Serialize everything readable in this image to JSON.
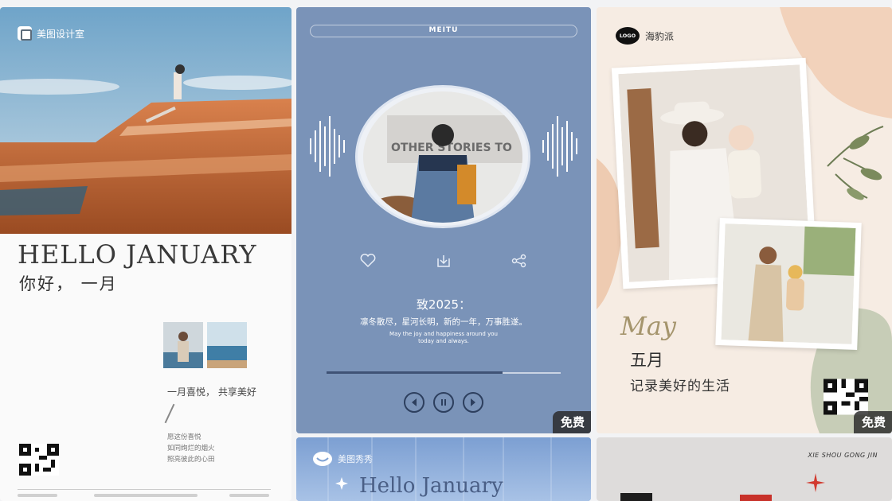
{
  "cards": [
    {
      "brand": "美图设计室",
      "title_en": "HELLO JANUARY",
      "title_cn": "你好， 一月",
      "tagline": "一月喜悦， 共享美好",
      "poem": [
        "愿这份喜悦",
        "如同绚烂的烟火",
        "照亮彼此的心田"
      ],
      "badge": ""
    },
    {
      "top_label": "MEITU",
      "photo_sign": "OTHER STORIES TO",
      "title": "致2025：",
      "line_cn": "凛冬散尽，星河长明，新的一年，万事胜遂。",
      "line_en_1": "May the joy and happiness around you",
      "line_en_2": "today and always.",
      "progress": 0.75,
      "badge": "免费"
    },
    {
      "logo": "LOGO",
      "brand": "海豹派",
      "script_title": "May",
      "month": "五月",
      "subtitle": "记录美好的生活",
      "badge": "免费"
    },
    {
      "brand": "美图秀秀",
      "title": "Hello January"
    },
    {
      "top_text": "XIE SHOU GONG JIN"
    }
  ],
  "icons": [
    "heart-icon",
    "download-icon",
    "share-icon",
    "prev-icon",
    "pause-icon",
    "next-icon",
    "qr-code-icon"
  ]
}
